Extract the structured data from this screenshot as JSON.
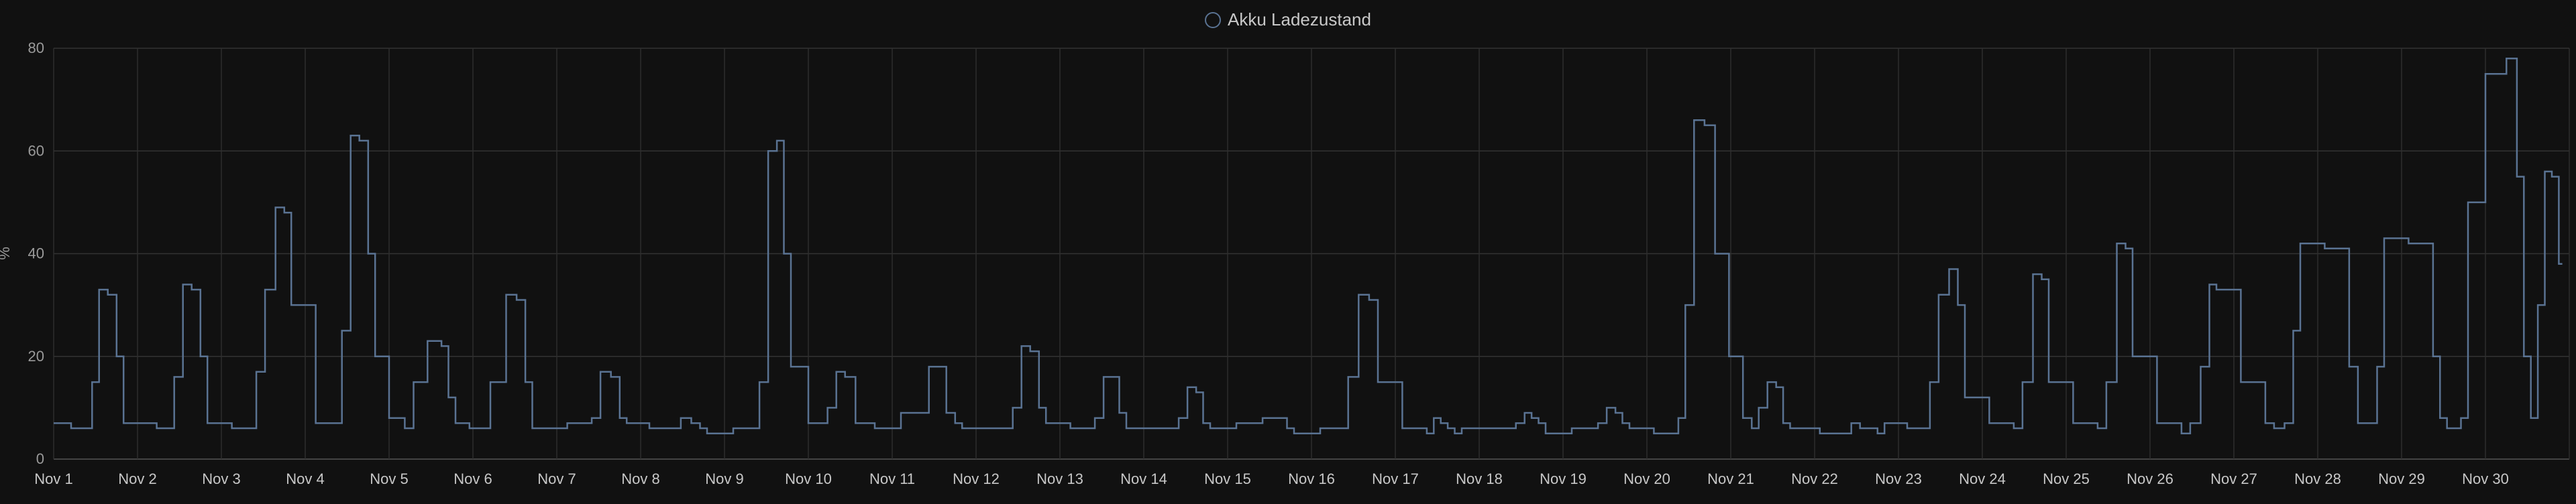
{
  "chart_data": {
    "type": "line",
    "title": "",
    "legend_position": "top-center",
    "grid": true,
    "ylabel": "%",
    "xlabel": "",
    "ylim": [
      0,
      80
    ],
    "y_ticks": [
      "0",
      "20",
      "40",
      "60",
      "80"
    ],
    "x_ticks": [
      "Nov 1",
      "Nov 2",
      "Nov 3",
      "Nov 4",
      "Nov 5",
      "Nov 6",
      "Nov 7",
      "Nov 8",
      "Nov 9",
      "Nov 10",
      "Nov 11",
      "Nov 12",
      "Nov 13",
      "Nov 14",
      "Nov 15",
      "Nov 16",
      "Nov 17",
      "Nov 18",
      "Nov 19",
      "Nov 20",
      "Nov 21",
      "Nov 22",
      "Nov 23",
      "Nov 24",
      "Nov 25",
      "Nov 26",
      "Nov 27",
      "Nov 28",
      "Nov 29",
      "Nov 30"
    ],
    "xlim": [
      "Nov 1",
      "Nov 31"
    ],
    "series": [
      {
        "name": "Akku Ladezustand",
        "color": "#5a7393",
        "x": [
          "Nov 1 00:00",
          "Nov 1 10:00",
          "Nov 1 12:00",
          "Nov 1 14:00",
          "Nov 1 17:00",
          "Nov 1 19:00",
          "Nov 1 21:00",
          "Nov 2 02:00",
          "Nov 2 09:00",
          "Nov 2 12:00",
          "Nov 2 14:00",
          "Nov 2 17:00",
          "Nov 2 19:00",
          "Nov 2 21:00",
          "Nov 3 09:00",
          "Nov 3 11:00",
          "Nov 3 14:00",
          "Nov 3 17:00",
          "Nov 3 19:00",
          "Nov 3 21:00",
          "Nov 4 09:00",
          "Nov 4 12:00",
          "Nov 4 14:00",
          "Nov 4 17:00",
          "Nov 4 19:00",
          "Nov 4 21:00",
          "Nov 5 03:00",
          "Nov 5 06:00",
          "Nov 5 08:00",
          "Nov 5 14:00",
          "Nov 5 16:00",
          "Nov 5 18:00",
          "Nov 5 20:00",
          "Nov 6 02:00",
          "Nov 6 08:00",
          "Nov 6 11:00",
          "Nov 6 14:00",
          "Nov 6 16:00",
          "Nov 6 18:00",
          "Nov 6 21:00",
          "Nov 7 09:00",
          "Nov 7 11:00",
          "Nov 7 14:00",
          "Nov 7 17:00",
          "Nov 7 19:00",
          "Nov 7 21:00",
          "Nov 8 08:00",
          "Nov 8 10:00",
          "Nov 8 13:00",
          "Nov 8 16:00",
          "Nov 8 18:00",
          "Nov 8 20:00",
          "Nov 9 09:00",
          "Nov 9 11:00",
          "Nov 9 14:00",
          "Nov 9 16:00",
          "Nov 9 18:00",
          "Nov 9 20:00",
          "Nov 10 04:00",
          "Nov 10 07:00",
          "Nov 10 09:00",
          "Nov 10 12:00",
          "Nov 10 15:00",
          "Nov 10 18:00",
          "Nov 10 20:00",
          "Nov 11 09:00",
          "Nov 11 12:00",
          "Nov 11 14:00",
          "Nov 11 17:00",
          "Nov 11 19:00",
          "Nov 11 21:00",
          "Nov 12 09:00",
          "Nov 12 12:00",
          "Nov 12 14:00",
          "Nov 12 17:00",
          "Nov 12 19:00",
          "Nov 12 21:00",
          "Nov 13 09:00",
          "Nov 13 11:00",
          "Nov 13 14:00",
          "Nov 13 16:00",
          "Nov 13 18:00",
          "Nov 13 20:00",
          "Nov 14 09:00",
          "Nov 14 11:00",
          "Nov 14 14:00",
          "Nov 14 16:00",
          "Nov 14 18:00",
          "Nov 14 20:00",
          "Nov 15 09:00",
          "Nov 15 11:00",
          "Nov 15 14:00",
          "Nov 15 16:00",
          "Nov 15 18:00",
          "Nov 15 20:00",
          "Nov 16 09:00",
          "Nov 16 12:00",
          "Nov 16 15:00",
          "Nov 16 18:00",
          "Nov 16 20:00",
          "Nov 17 08:00",
          "Nov 17 10:00",
          "Nov 17 12:00",
          "Nov 17 14:00",
          "Nov 17 16:00",
          "Nov 17 18:00",
          "Nov 17 20:00",
          "Nov 18 09:00",
          "Nov 18 12:00",
          "Nov 18 14:00",
          "Nov 18 16:00",
          "Nov 18 18:00",
          "Nov 18 20:00",
          "Nov 19 09:00",
          "Nov 19 11:00",
          "Nov 19 14:00",
          "Nov 19 16:00",
          "Nov 19 18:00",
          "Nov 19 20:00",
          "Nov 20 08:00",
          "Nov 20 10:00",
          "Nov 20 12:00",
          "Nov 20 15:00",
          "Nov 20 18:00",
          "Nov 20 21:00",
          "Nov 21 02:00",
          "Nov 21 05:00",
          "Nov 21 07:00",
          "Nov 21 09:00",
          "Nov 21 12:00",
          "Nov 21 14:00",
          "Nov 21 16:00",
          "Nov 21 18:00",
          "Nov 22 09:00",
          "Nov 22 12:00",
          "Nov 22 14:00",
          "Nov 22 17:00",
          "Nov 22 19:00",
          "Nov 22 21:00",
          "Nov 23 08:00",
          "Nov 23 10:00",
          "Nov 23 13:00",
          "Nov 23 16:00",
          "Nov 23 18:00",
          "Nov 23 20:00",
          "Nov 24 08:00",
          "Nov 24 10:00",
          "Nov 24 13:00",
          "Nov 24 16:00",
          "Nov 24 18:00",
          "Nov 24 20:00",
          "Nov 25 08:00",
          "Nov 25 10:00",
          "Nov 25 13:00",
          "Nov 25 16:00",
          "Nov 25 18:00",
          "Nov 25 20:00",
          "Nov 26 08:00",
          "Nov 26 10:00",
          "Nov 26 13:00",
          "Nov 26 16:00",
          "Nov 26 18:00",
          "Nov 26 20:00",
          "Nov 27 08:00",
          "Nov 27 10:00",
          "Nov 27 13:00",
          "Nov 27 16:00",
          "Nov 27 18:00",
          "Nov 27 20:00",
          "Nov 28 08:00",
          "Nov 28 10:00",
          "Nov 28 13:00",
          "Nov 28 16:00",
          "Nov 28 18:00",
          "Nov 28 20:00",
          "Nov 29 08:00",
          "Nov 29 10:00",
          "Nov 29 12:00",
          "Nov 29 14:00",
          "Nov 29 16:00",
          "Nov 29 18:00",
          "Nov 29 20:00",
          "Nov 30 04:00",
          "Nov 30 08:00",
          "Nov 30 10:00",
          "Nov 30 12:00",
          "Nov 30 14:00",
          "Nov 30 16:00",
          "Nov 30 18:00",
          "Nov 30 20:00",
          "Nov 30 22:00"
        ],
        "values": [
          7,
          6,
          15,
          33,
          32,
          20,
          7,
          7,
          6,
          16,
          34,
          33,
          20,
          7,
          6,
          17,
          33,
          49,
          48,
          30,
          7,
          25,
          63,
          62,
          40,
          20,
          8,
          6,
          15,
          23,
          22,
          12,
          7,
          6,
          15,
          32,
          31,
          15,
          6,
          6,
          7,
          8,
          17,
          16,
          8,
          7,
          6,
          6,
          8,
          7,
          6,
          5,
          6,
          15,
          60,
          62,
          40,
          18,
          7,
          10,
          17,
          16,
          7,
          7,
          6,
          9,
          18,
          18,
          9,
          7,
          6,
          6,
          10,
          22,
          21,
          10,
          7,
          6,
          8,
          16,
          16,
          9,
          6,
          6,
          8,
          14,
          13,
          7,
          6,
          7,
          8,
          8,
          8,
          6,
          5,
          6,
          16,
          32,
          31,
          15,
          6,
          5,
          8,
          7,
          6,
          5,
          6,
          6,
          7,
          9,
          8,
          7,
          5,
          6,
          7,
          10,
          9,
          7,
          6,
          5,
          8,
          30,
          66,
          65,
          40,
          20,
          8,
          6,
          10,
          15,
          14,
          7,
          6,
          5,
          7,
          6,
          6,
          5,
          7,
          6,
          15,
          32,
          37,
          30,
          12,
          7,
          6,
          15,
          36,
          35,
          15,
          7,
          6,
          15,
          42,
          41,
          20,
          7,
          5,
          7,
          18,
          34,
          33,
          15,
          7,
          6,
          7,
          25,
          42,
          41,
          18,
          7,
          7,
          18,
          43,
          42,
          20,
          8,
          6,
          6,
          8,
          50,
          75,
          78,
          55,
          20,
          8,
          30,
          56,
          55,
          38
        ]
      }
    ]
  }
}
